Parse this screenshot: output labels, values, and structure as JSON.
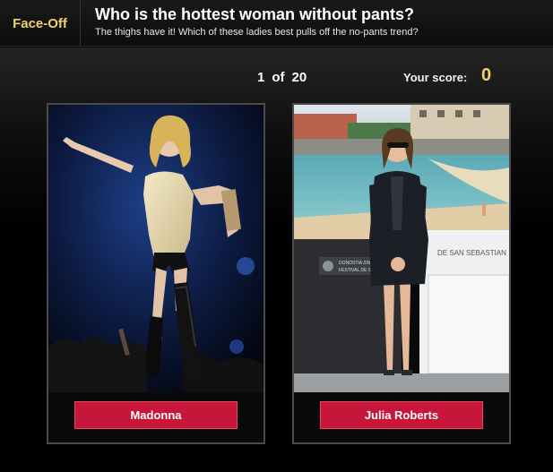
{
  "brand": "Face-Off",
  "quiz": {
    "title": "Who is the hottest woman without pants?",
    "subtitle": "The thighs have it! Which of these ladies best pulls off the no-pants trend?"
  },
  "progress": {
    "current": "1",
    "of_label": "of",
    "total": "20"
  },
  "score": {
    "label": "Your score:",
    "value": "0"
  },
  "choices": [
    {
      "label": "Madonna",
      "image": "photo-concert-performer"
    },
    {
      "label": "Julia Roberts",
      "image": "photo-beach-photocall"
    }
  ],
  "photo_text": {
    "sign_1": "DONOSTIA ZINE",
    "sign_2": "FESTIVAL DE S",
    "sign_3": "DE SAN SEBASTIAN"
  },
  "colors": {
    "accent": "#f0cf6d",
    "button": "#c8153a"
  }
}
